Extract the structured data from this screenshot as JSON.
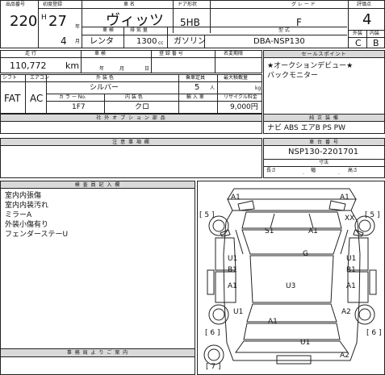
{
  "header": {
    "lot_label": "出品番号",
    "lot_no": "220",
    "reg_label": "初度登録",
    "era": "H",
    "year": "27",
    "year_unit": "年",
    "month": "4",
    "month_unit": "月",
    "name_label": "車  名",
    "car_name": "ヴィッツ",
    "door_label": "ドア形状",
    "door": "5HB",
    "grade_label": "グ レ ー ド",
    "grade": "F",
    "score_label": "評価点",
    "score": "4",
    "shaken_label": "車 検",
    "shaken": "レンタ",
    "disp_label": "排 気 量",
    "disp": "1300",
    "disp_unit": "cc",
    "fuel": "ガソリン",
    "type_label": "型  式",
    "model": "DBA-NSP130",
    "ext_label": "外装",
    "ext_grade": "C",
    "int_label": "内装",
    "int_grade": "B"
  },
  "row2": {
    "mileage_label": "走 行",
    "mileage": "110,772",
    "mileage_unit": "km",
    "rpm_label": "車 検",
    "rpm_year": "年",
    "rpm_month": "月",
    "rpm_day": "日",
    "regno_label": "登 録 番 号",
    "recycle_label": "名変期限",
    "sales_label": "セールスポイント",
    "sales_text": "★オークションデビュー★\nバックモニター"
  },
  "row3": {
    "shift_label": "シフト",
    "ac_label": "エアコン",
    "shift": "FAT",
    "ac": "AC",
    "color_label": "外 装 色",
    "color": "シルバー",
    "color_no_label": "カ ラ ー No.",
    "color_no": "1F7",
    "int_color_label": "内 装 色",
    "int_color": "クロ",
    "seats_label": "乗車定員",
    "seats": "5",
    "seats_unit": "人",
    "load_label": "最大積載量",
    "load_unit": "kg",
    "import_label": "輸 入 車",
    "recycle_fee_label": "リサイクル料金",
    "recycle_fee": "9,000円"
  },
  "equip": {
    "equip_label": "装 備 品 ",
    "std_label": "純 正 装 備",
    "std_text": "ナビ ABS エアB PS PW",
    "options_label": "社 外 オ プ シ ョ ン 部 品"
  },
  "notes": {
    "notes_label": "注 意 事 項 欄",
    "chassis_label": "車 台 番 号",
    "chassis": "NSP130-2201701",
    "size_label": "寸法",
    "length": "長さ",
    "width": "幅",
    "height": "高さ"
  },
  "inspector": {
    "label": "検 査 員 記 入 欄",
    "lines": [
      "室内内張傷",
      "室内内装汚れ",
      "ミラーA",
      "外装小傷有り",
      "フェンダーステーU"
    ],
    "office_label": "事 務 局 よ り ご 案 内"
  },
  "diagram": {
    "marks": [
      {
        "id": "A1",
        "t": "A1"
      },
      {
        "id": "A1b",
        "t": "A1"
      },
      {
        "id": "s5l",
        "t": "[ 5 ]"
      },
      {
        "id": "s5r",
        "t": "[ 5 ]"
      },
      {
        "id": "XX",
        "t": "XX"
      },
      {
        "id": "S1",
        "t": "S1"
      },
      {
        "id": "A1c",
        "t": "A1"
      },
      {
        "id": "G",
        "t": "G"
      },
      {
        "id": "U1a",
        "t": "U1"
      },
      {
        "id": "B1a",
        "t": "B1"
      },
      {
        "id": "U1b",
        "t": "U1"
      },
      {
        "id": "B1b",
        "t": "B1"
      },
      {
        "id": "A1d",
        "t": "A1"
      },
      {
        "id": "U3",
        "t": "U3"
      },
      {
        "id": "A1e",
        "t": "A1"
      },
      {
        "id": "U1c",
        "t": "U1"
      },
      {
        "id": "A2a",
        "t": "A2"
      },
      {
        "id": "s6l",
        "t": "[ 6 ]"
      },
      {
        "id": "s6r",
        "t": "[ 6 ]"
      },
      {
        "id": "A1f",
        "t": "A1"
      },
      {
        "id": "U1d",
        "t": "U1"
      },
      {
        "id": "s7",
        "t": "[ 7 ]"
      },
      {
        "id": "A2b",
        "t": "A2"
      }
    ]
  }
}
